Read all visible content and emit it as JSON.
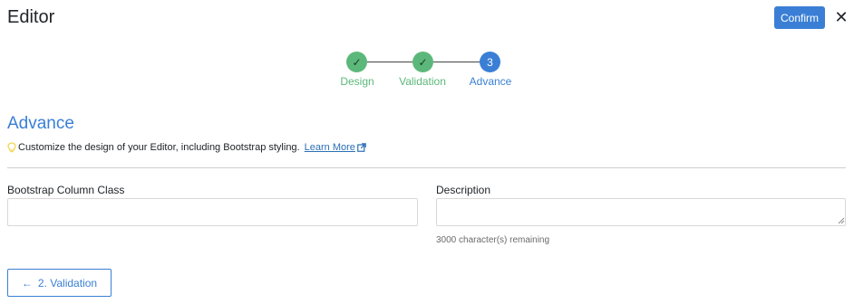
{
  "header": {
    "title": "Editor",
    "confirm_label": "Confirm",
    "close_glyph": "✕"
  },
  "stepper": {
    "steps": [
      {
        "label": "Design",
        "status": "done",
        "marker": "✓"
      },
      {
        "label": "Validation",
        "status": "done",
        "marker": "✓"
      },
      {
        "label": "Advance",
        "status": "active",
        "marker": "3"
      }
    ]
  },
  "section": {
    "heading": "Advance",
    "hint_text": "Customize the design of your Editor, including Bootstrap styling.",
    "learn_more_label": "Learn More"
  },
  "fields": {
    "bootstrap_label": "Bootstrap Column Class",
    "bootstrap_value": "",
    "description_label": "Description",
    "description_value": "",
    "char_remaining": "3000 character(s) remaining"
  },
  "footer": {
    "back_label": "2. Validation",
    "back_arrow": "←"
  },
  "colors": {
    "accent": "#3a7fd5",
    "success": "#5cb87a",
    "hint_icon": "#f2d54c"
  }
}
